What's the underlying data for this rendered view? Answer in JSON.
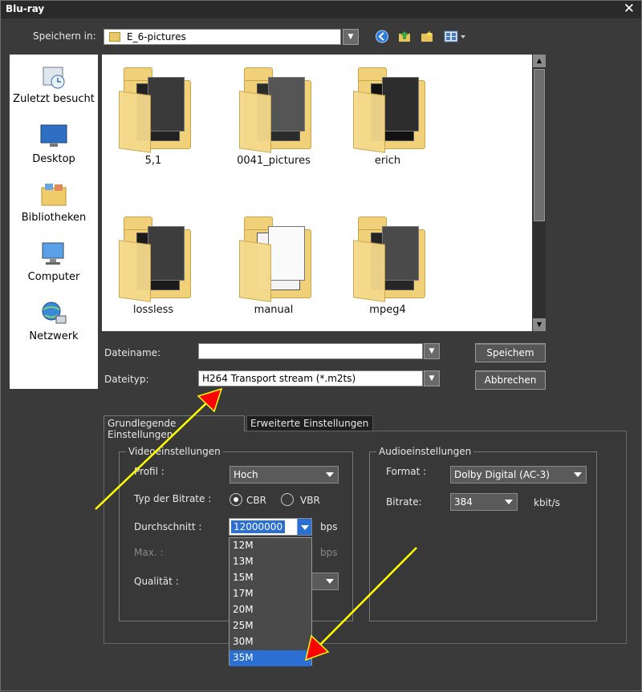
{
  "window": {
    "title": "Blu-ray",
    "close_glyph": "✕"
  },
  "location": {
    "label": "Speichern in:",
    "value": "E_6-pictures"
  },
  "places": [
    {
      "label": "Zuletzt besucht",
      "icon": "recent-places-icon"
    },
    {
      "label": "Desktop",
      "icon": "desktop-icon"
    },
    {
      "label": "Bibliotheken",
      "icon": "libraries-icon"
    },
    {
      "label": "Computer",
      "icon": "computer-icon"
    },
    {
      "label": "Netzwerk",
      "icon": "network-icon"
    }
  ],
  "folders": [
    {
      "name": "5,1"
    },
    {
      "name": "0041_pictures"
    },
    {
      "name": "erich"
    },
    {
      "name": "lossless"
    },
    {
      "name": "manual"
    },
    {
      "name": "mpeg4"
    }
  ],
  "file": {
    "name_label": "Dateiname:",
    "name_value": "",
    "type_label": "Dateityp:",
    "type_value": "H264 Transport stream (*.m2ts)"
  },
  "buttons": {
    "save": "Speichem",
    "cancel": "Abbrechen"
  },
  "tabs": [
    {
      "label": "Grundlegende Einstellungen",
      "active": true
    },
    {
      "label": "Erweiterte Einstellungen",
      "active": false
    }
  ],
  "video": {
    "group_title": "Videoeinstellungen",
    "profile_label": "Profil :",
    "profile_value": "Hoch",
    "bitrate_type_label": "Typ der Bitrate :",
    "cbr_label": "CBR",
    "vbr_label": "VBR",
    "bitrate_type_selected": "CBR",
    "average_label": "Durchschnitt :",
    "average_value": "12000000",
    "average_unit": "bps",
    "max_label": "Max. :",
    "max_unit": "bps",
    "quality_label": "Qualität :",
    "average_options": [
      "12M",
      "13M",
      "15M",
      "17M",
      "20M",
      "25M",
      "30M",
      "35M"
    ],
    "average_highlighted": "35M"
  },
  "audio": {
    "group_title": "Audioeinstellungen",
    "format_label": "Format :",
    "format_value": "Dolby Digital (AC-3)",
    "bitrate_label": "Bitrate:",
    "bitrate_value": "384",
    "bitrate_unit": "kbit/s"
  },
  "colors": {
    "annotation_arrow": "#ffff00",
    "arrow_head": "#ff0000",
    "selection": "#2a6fd1"
  }
}
